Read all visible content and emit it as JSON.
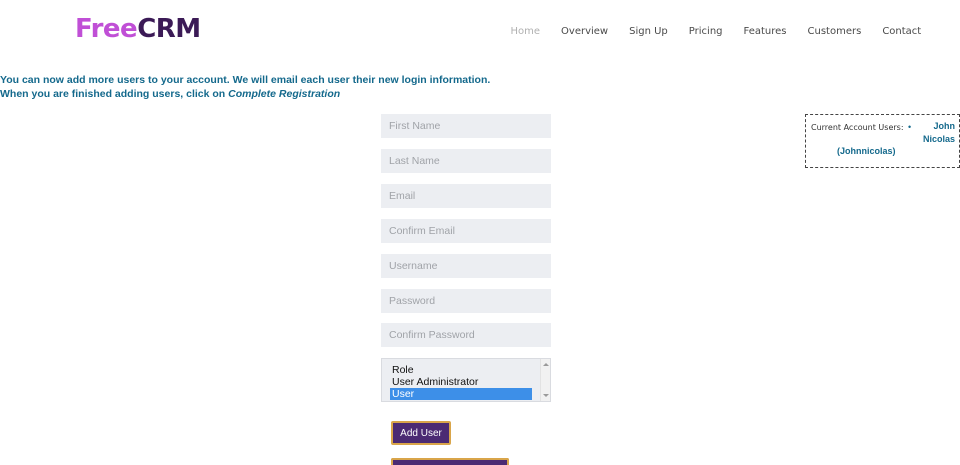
{
  "brand": {
    "free": "Free",
    "crm": "CRM"
  },
  "nav": [
    "Home",
    "Overview",
    "Sign Up",
    "Pricing",
    "Features",
    "Customers",
    "Contact"
  ],
  "intro": {
    "line1": "You can now add more users to your account. We will email each user their new login information.",
    "line2_prefix": "When you are finished adding users, click on ",
    "line2_emphasis": "Complete Registration"
  },
  "form": {
    "first_name_placeholder": "First Name",
    "last_name_placeholder": "Last Name",
    "email_placeholder": "Email",
    "confirm_email_placeholder": "Confirm Email",
    "username_placeholder": "Username",
    "password_placeholder": "Password",
    "confirm_password_placeholder": "Confirm Password",
    "role_options": [
      "Role",
      "User Administrator",
      "User"
    ],
    "role_selected": "User",
    "add_user_label": "Add User"
  },
  "current_users": {
    "label": "Current Account Users:",
    "users": [
      {
        "name_line1": "John",
        "name_line2": "Nicolas",
        "username": "(Johnnicolas)"
      }
    ]
  },
  "colors": {
    "accent_purple": "#4b2a73",
    "button_border": "#d9a54a",
    "text_blue": "#14698c",
    "logo_pink": "#c04fd6",
    "logo_dark": "#3b1a56"
  }
}
